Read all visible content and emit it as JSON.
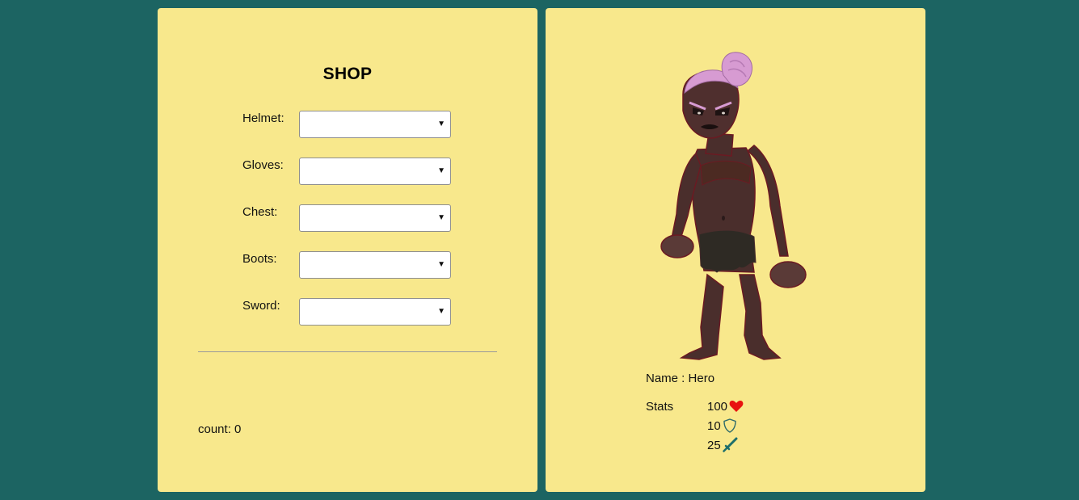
{
  "shop": {
    "title": "SHOP",
    "items": [
      {
        "label": "Helmet:",
        "value": ""
      },
      {
        "label": "Gloves:",
        "value": ""
      },
      {
        "label": "Chest:",
        "value": ""
      },
      {
        "label": "Boots:",
        "value": ""
      },
      {
        "label": "Sword:",
        "value": ""
      }
    ],
    "count_label": "count:",
    "count_value": "0"
  },
  "hero": {
    "name_label": "Name :",
    "name_value": "Hero",
    "stats_label": "Stats",
    "stats": [
      {
        "value": "100",
        "icon": "heart-icon",
        "color": "#e8130f"
      },
      {
        "value": "10",
        "icon": "shield-icon",
        "color": "#2f6b6a"
      },
      {
        "value": "25",
        "icon": "sword-icon",
        "color": "#1e6f6b"
      }
    ]
  },
  "colors": {
    "background": "#1c6462",
    "panel": "#f8e88c"
  }
}
